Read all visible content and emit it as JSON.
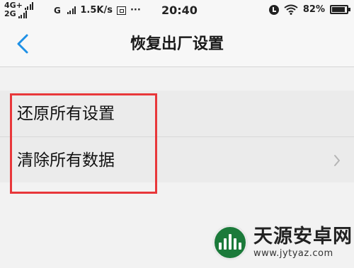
{
  "status_bar": {
    "network_line1": "4G+",
    "network_line2": "2G",
    "network_extra": "G",
    "speed": "1.5K/s",
    "more": "···",
    "time": "20:40",
    "battery": "82%",
    "icons": [
      "signal-icon",
      "data-saver-icon",
      "alarm-icon",
      "wifi-icon",
      "battery-icon"
    ]
  },
  "header": {
    "title": "恢复出厂设置",
    "back_icon": "chevron-left-icon"
  },
  "list": {
    "items": [
      {
        "label": "还原所有设置"
      },
      {
        "label": "清除所有数据",
        "icon": "chevron-right-icon"
      }
    ]
  },
  "watermark": {
    "name": "天源安卓网",
    "url": "www.jytyaz.com"
  },
  "colors": {
    "accent_blue": "#1e90e6",
    "highlight_red": "#e8373a",
    "logo_green": "#1b7a3a"
  }
}
